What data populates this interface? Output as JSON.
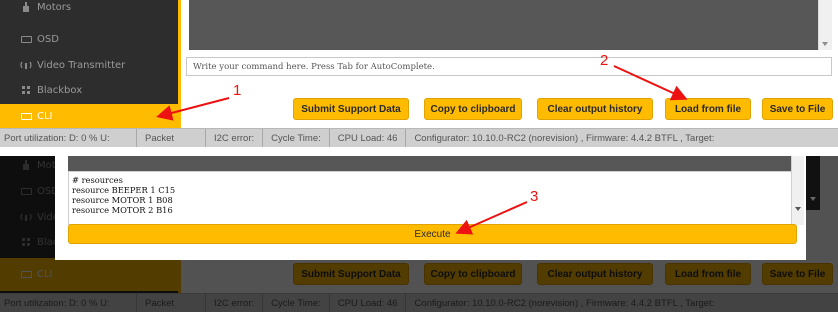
{
  "sidebar": {
    "items": [
      {
        "label": "Motors",
        "icon": "motor-icon"
      },
      {
        "label": "OSD",
        "icon": "osd-icon"
      },
      {
        "label": "Video Transmitter",
        "icon": "video-transmitter-icon"
      },
      {
        "label": "Blackbox",
        "icon": "blackbox-icon"
      },
      {
        "label": "CLI",
        "icon": "cli-icon",
        "active": true
      }
    ]
  },
  "cli": {
    "input_placeholder": "Write your command here. Press Tab for AutoComplete.",
    "buttons": {
      "submit_support": "Submit Support Data",
      "copy_clipboard": "Copy to clipboard",
      "clear_history": "Clear output history",
      "load_file": "Load from file",
      "save_file": "Save to File"
    }
  },
  "status_bar": {
    "port_utilization": "Port utilization: D: 0 % U:",
    "packet": "Packet",
    "i2c_error": "I2C error:",
    "cycle_time": "Cycle Time:",
    "cpu_load": "CPU Load: 46",
    "configurator": "Configurator: 10.10.0-RC2 (norevision) , Firmware: 4.4.2 BTFL , Target:"
  },
  "dialog": {
    "lines": [
      "# resources",
      "resource BEEPER 1 C15",
      "resource MOTOR 1 B08",
      "resource MOTOR 2 B16"
    ],
    "execute_label": "Execute"
  },
  "annotations": {
    "step1": "1",
    "step2": "2",
    "step3": "3",
    "color": "#ee1111"
  },
  "colors": {
    "accent": "#ffbb00",
    "sidebar_bg": "#2d2d2d",
    "console_bg": "#575757"
  }
}
